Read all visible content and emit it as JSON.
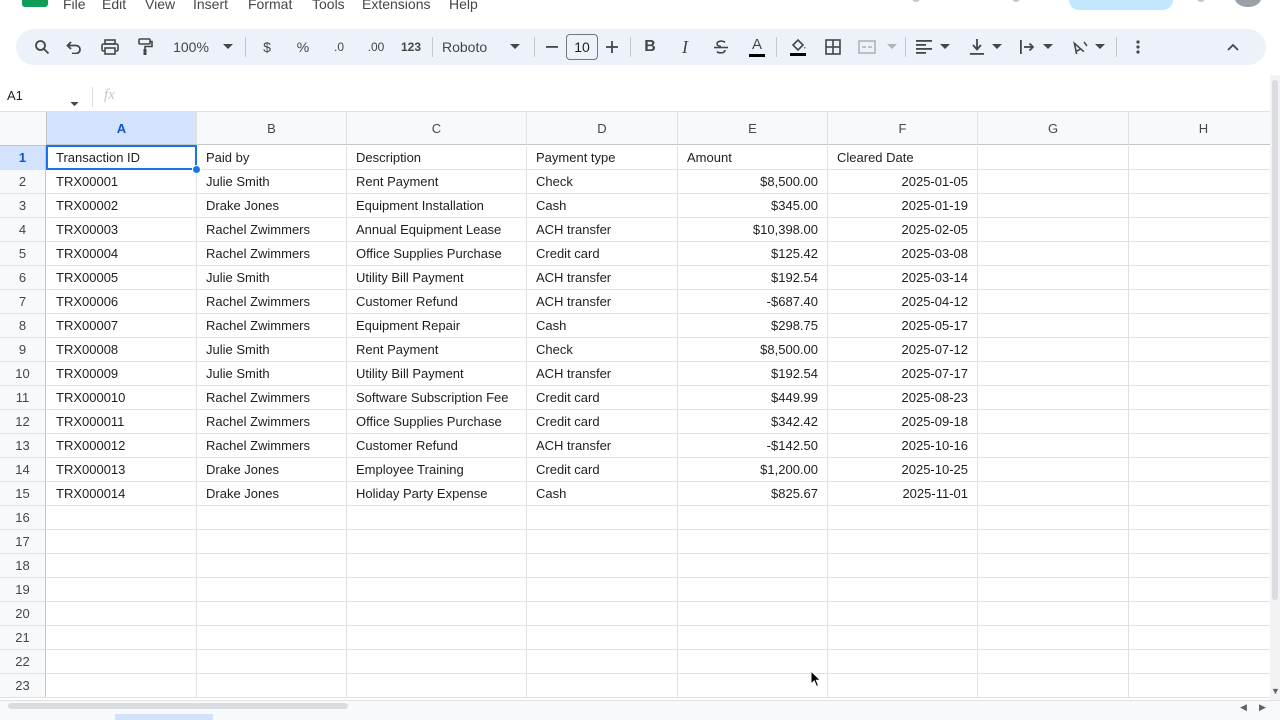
{
  "menu": [
    "File",
    "Edit",
    "View",
    "Insert",
    "Format",
    "Tools",
    "Extensions",
    "Help"
  ],
  "toolbar": {
    "zoom": "100%",
    "currency": "$",
    "percent": "%",
    "dec_decrease": ".0",
    "dec_increase": ".00",
    "more_formats": "123",
    "font": "Roboto",
    "font_size": "10",
    "bold": "B",
    "italic": "I",
    "text_color": "A"
  },
  "formula_bar": {
    "name_box": "A1",
    "fx": "fx",
    "formula": ""
  },
  "columns": [
    "A",
    "B",
    "C",
    "D",
    "E",
    "F",
    "G",
    "H"
  ],
  "rows": [
    "1",
    "2",
    "3",
    "4",
    "5",
    "6",
    "7",
    "8",
    "9",
    "10",
    "11",
    "12",
    "13",
    "14",
    "15",
    "16",
    "17",
    "18",
    "19",
    "20",
    "21",
    "22",
    "23"
  ],
  "table": {
    "headers": [
      "Transaction ID",
      "Paid by",
      "Description",
      "Payment type",
      "Amount",
      "Cleared Date"
    ],
    "rows": [
      [
        "TRX00001",
        "Julie Smith",
        "Rent Payment",
        "Check",
        "$8,500.00",
        "2025-01-05"
      ],
      [
        "TRX00002",
        "Drake Jones",
        "Equipment Installation",
        "Cash",
        "$345.00",
        "2025-01-19"
      ],
      [
        "TRX00003",
        "Rachel Zwimmers",
        "Annual Equipment Lease",
        "ACH transfer",
        "$10,398.00",
        "2025-02-05"
      ],
      [
        "TRX00004",
        "Rachel Zwimmers",
        "Office Supplies Purchase",
        "Credit card",
        "$125.42",
        "2025-03-08"
      ],
      [
        "TRX00005",
        "Julie Smith",
        "Utility Bill Payment",
        "ACH transfer",
        "$192.54",
        "2025-03-14"
      ],
      [
        "TRX00006",
        "Rachel Zwimmers",
        "Customer Refund",
        "ACH transfer",
        "-$687.40",
        "2025-04-12"
      ],
      [
        "TRX00007",
        "Rachel Zwimmers",
        "Equipment Repair",
        "Cash",
        "$298.75",
        "2025-05-17"
      ],
      [
        "TRX00008",
        "Julie Smith",
        "Rent Payment",
        "Check",
        "$8,500.00",
        "2025-07-12"
      ],
      [
        "TRX00009",
        "Julie Smith",
        "Utility Bill Payment",
        "ACH transfer",
        "$192.54",
        "2025-07-17"
      ],
      [
        "TRX000010",
        "Rachel Zwimmers",
        "Software Subscription Fee",
        "Credit card",
        "$449.99",
        "2025-08-23"
      ],
      [
        "TRX000011",
        "Rachel Zwimmers",
        "Office Supplies Purchase",
        "Credit card",
        "$342.42",
        "2025-09-18"
      ],
      [
        "TRX000012",
        "Rachel Zwimmers",
        "Customer Refund",
        "ACH transfer",
        "-$142.50",
        "2025-10-16"
      ],
      [
        "TRX000013",
        "Drake Jones",
        "Employee Training",
        "Credit card",
        "$1,200.00",
        "2025-10-25"
      ],
      [
        "TRX000014",
        "Drake Jones",
        "Holiday Party Expense",
        "Cash",
        "$825.67",
        "2025-11-01"
      ]
    ]
  },
  "selection": {
    "active_cell": "A1",
    "column": "A",
    "row": "1"
  },
  "colors": {
    "accent": "#1a73e8",
    "selected_header": "#d3e3fd",
    "toolbar_bg": "#edf2fa",
    "logo": "#0f9d58"
  }
}
